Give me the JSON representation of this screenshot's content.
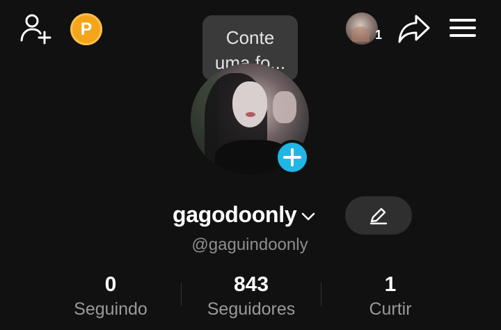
{
  "header": {
    "coin_letter": "P",
    "friend_count": "1"
  },
  "tooltip": {
    "text_line1": "Conte",
    "text_line2": "uma fo..."
  },
  "profile": {
    "display_name": "gagodoonly",
    "handle": "@gaguindoonly"
  },
  "stats": [
    {
      "value": "0",
      "label": "Seguindo"
    },
    {
      "value": "843",
      "label": "Seguidores"
    },
    {
      "value": "1",
      "label": "Curtir"
    }
  ],
  "colors": {
    "background": "#111111",
    "accent_blue": "#20b7e6",
    "coin_orange": "#f4a51c",
    "muted_text": "#8e8e8e"
  }
}
